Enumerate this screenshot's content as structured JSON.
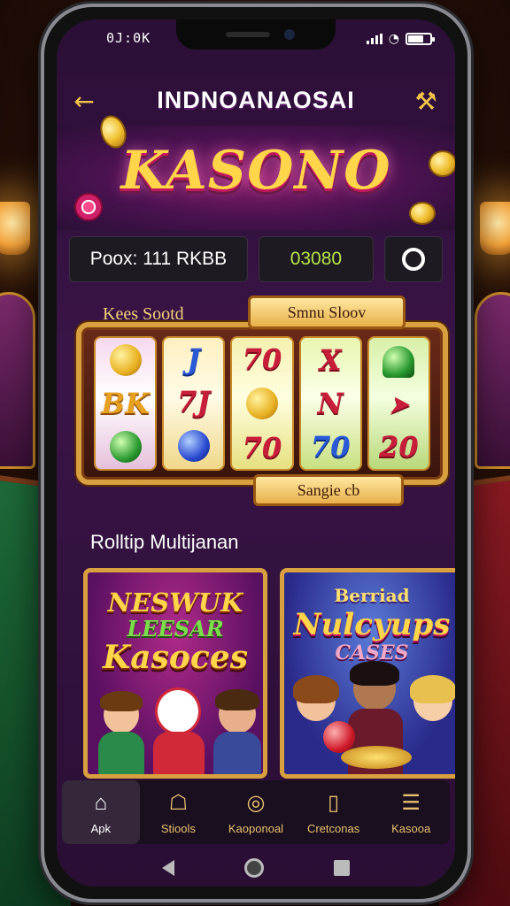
{
  "status_bar": {
    "time": "0J:0K"
  },
  "app_bar": {
    "title": "INDNOANAOSAI",
    "back_icon": "back-arrow-icon",
    "tools_icon": "tools-icon"
  },
  "banner": {
    "logo_text": "KASONO"
  },
  "info": {
    "balance": "Poox: 111 RKBB",
    "code": "03080"
  },
  "slot": {
    "side_label": "Kees Sootd",
    "top_sign": "Smnu Sloov",
    "bottom_sign": "Sangie cb",
    "reels": [
      [
        "coin",
        "BK",
        "orb"
      ],
      [
        "J",
        "7J",
        "orb"
      ],
      [
        "70",
        "orb",
        "70"
      ],
      [
        "X",
        "N",
        "70"
      ],
      [
        "arch",
        "fish",
        "20"
      ]
    ]
  },
  "section": {
    "title": "Rolltip Multijanan"
  },
  "games": [
    {
      "line1": "NESWUK",
      "line2": "LEESAR",
      "line3": "Kasoces"
    },
    {
      "line1": "Berriad",
      "line2": "Nulcyups",
      "line3": "CASES"
    }
  ],
  "bottom_nav": [
    {
      "label": "Apk",
      "icon": "home-icon",
      "active": true
    },
    {
      "label": "Stiools",
      "icon": "house-icon",
      "active": false
    },
    {
      "label": "Kaoponoal",
      "icon": "target-icon",
      "active": false
    },
    {
      "label": "Cretconas",
      "icon": "card-icon",
      "active": false
    },
    {
      "label": "Kasooa",
      "icon": "menu-icon",
      "active": false
    }
  ],
  "colors": {
    "accent": "#d9a040",
    "bg": "#2b0f36",
    "highlight": "#b6e64a"
  }
}
